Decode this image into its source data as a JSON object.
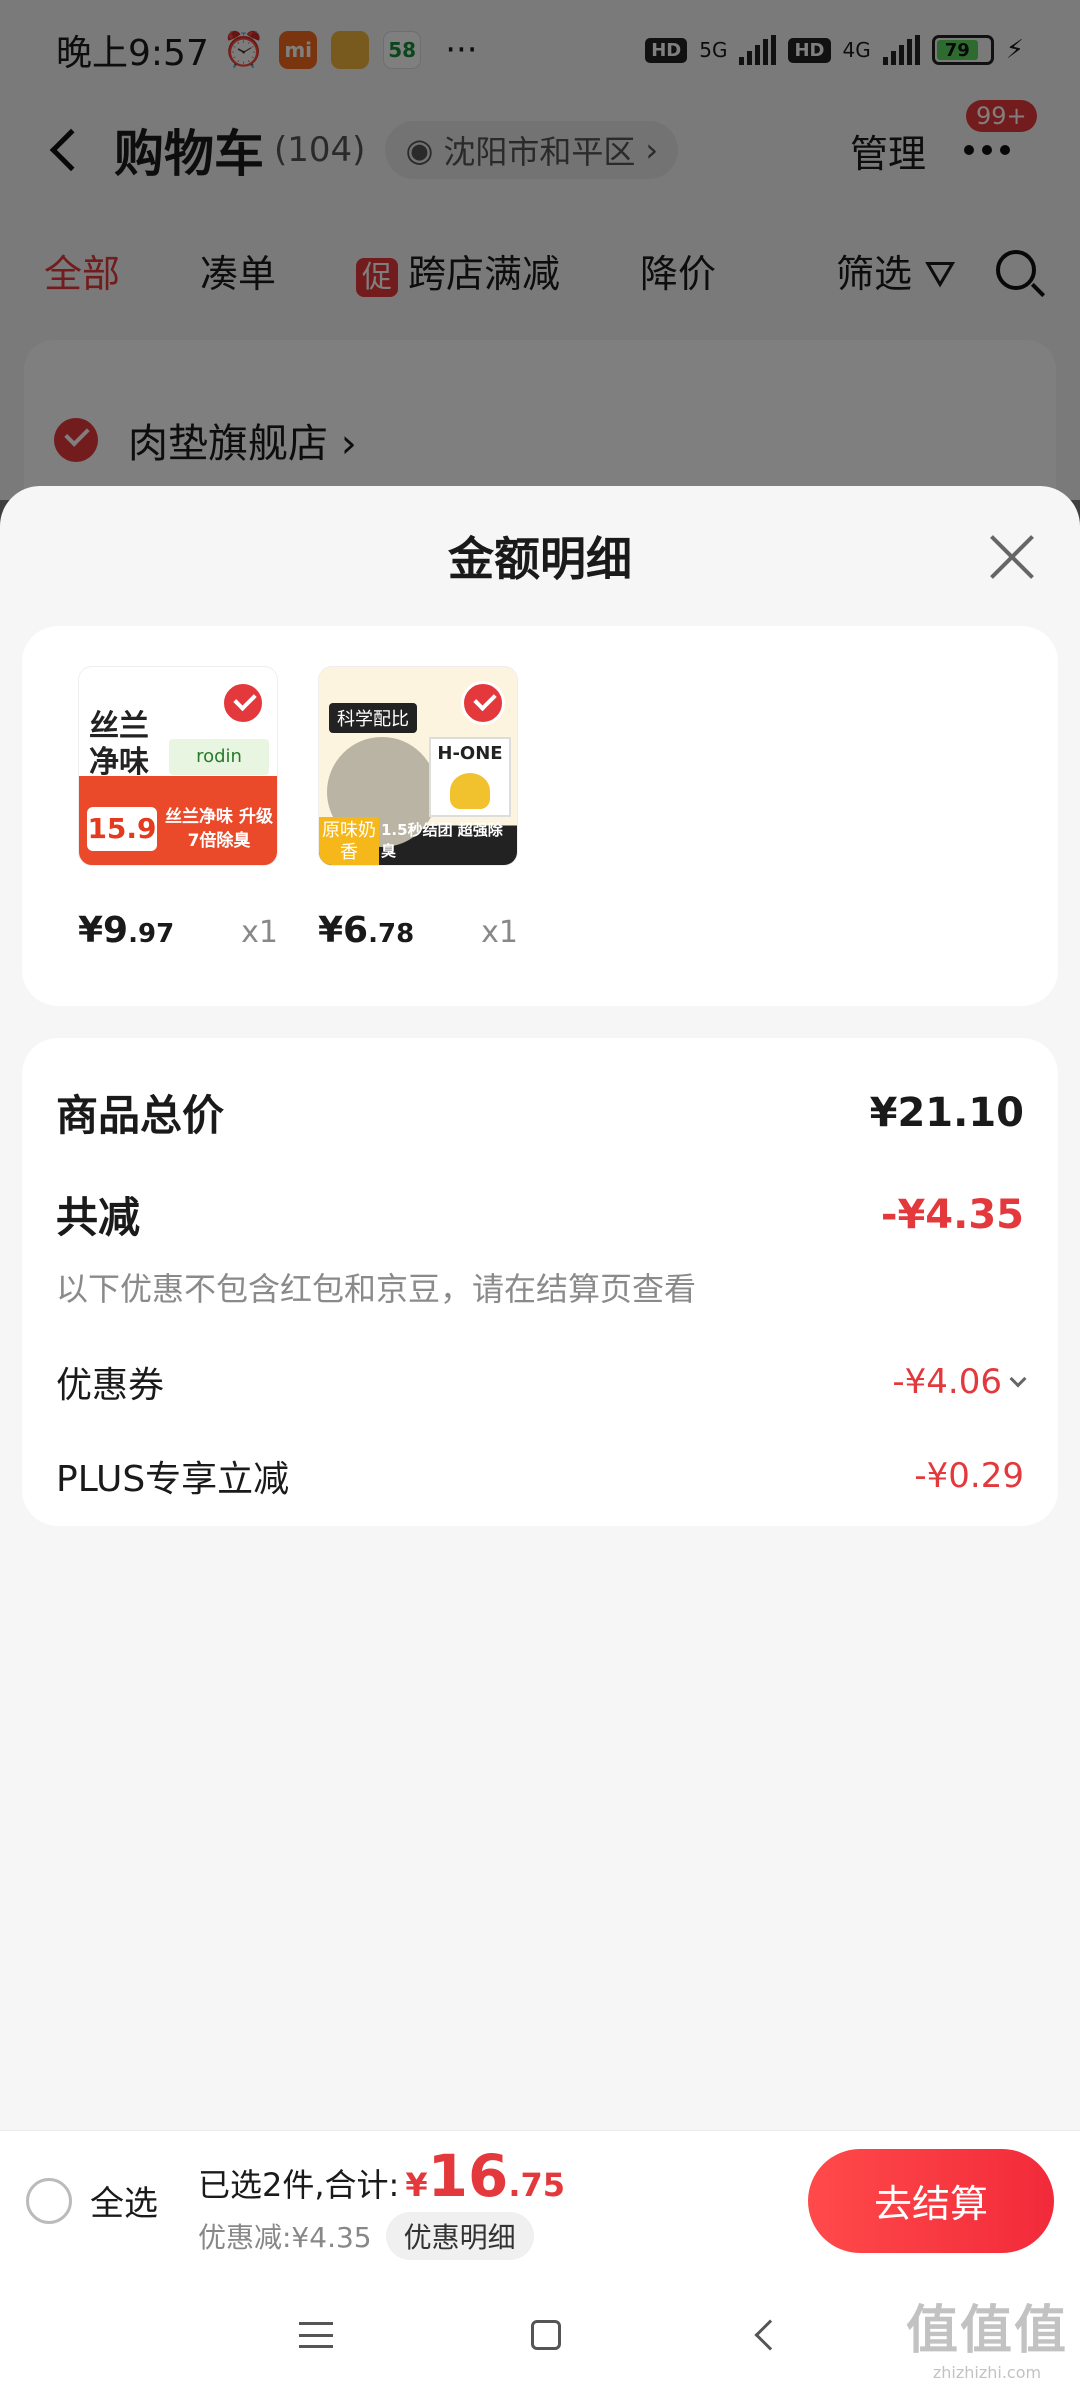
{
  "status_bar": {
    "time": "晚上9:57",
    "app_icons": [
      {
        "label": "mi",
        "color": "#f56a1e"
      },
      {
        "label": "",
        "color": "#f3b53c"
      },
      {
        "label": "58",
        "color": "#ffffff"
      }
    ],
    "more": "···",
    "network_labels": [
      "HD",
      "5G",
      "HD",
      "4G"
    ],
    "battery_level": "79"
  },
  "header": {
    "title": "购物车",
    "count": "(104)",
    "location": "沈阳市和平区",
    "manage_label": "管理",
    "more_badge": "99+"
  },
  "filter_tabs": {
    "items": [
      "全部",
      "凑单",
      "跨店满减",
      "降价",
      "筛选"
    ],
    "promo_tag": "促"
  },
  "store": {
    "name": "肉垫旗舰店"
  },
  "sheet": {
    "title": "金额明细",
    "products": [
      {
        "price_int": "¥9",
        "price_dec": ".97",
        "qty": "x1",
        "thumb_text": {
          "big": "丝兰净味",
          "brand": "rodin",
          "promo_price": "15.9",
          "slogan": "丝兰净味 升级7倍除臭"
        }
      },
      {
        "price_int": "¥6",
        "price_dec": ".78",
        "qty": "x1",
        "thumb_text": {
          "title": "科学配比",
          "bag": "H-ONE",
          "tag": "原味奶香",
          "bottom": "1.5秒结团 超强除臭"
        }
      }
    ],
    "summary": {
      "total_label": "商品总价",
      "total_value": "¥21.10",
      "reduce_label": "共减",
      "reduce_value": "-¥4.35",
      "note": "以下优惠不包含红包和京豆，请在结算页查看",
      "coupon_label": "优惠券",
      "coupon_value": "-¥4.06",
      "plus_label": "PLUS专享立减",
      "plus_value": "-¥0.29"
    }
  },
  "checkout": {
    "select_all": "全选",
    "selected_text": "已选2件,合计:",
    "sum_yen": "¥",
    "sum_int": "16",
    "sum_dec": ".75",
    "discount_text": "优惠减:¥4.35",
    "detail_button": "优惠明细",
    "checkout_button": "去结算"
  },
  "watermark": {
    "main": "值值值",
    "sub": "zhizhizhi.com"
  },
  "colors": {
    "accent": "#e4393c",
    "sheet_bg": "#f6f6f6"
  }
}
